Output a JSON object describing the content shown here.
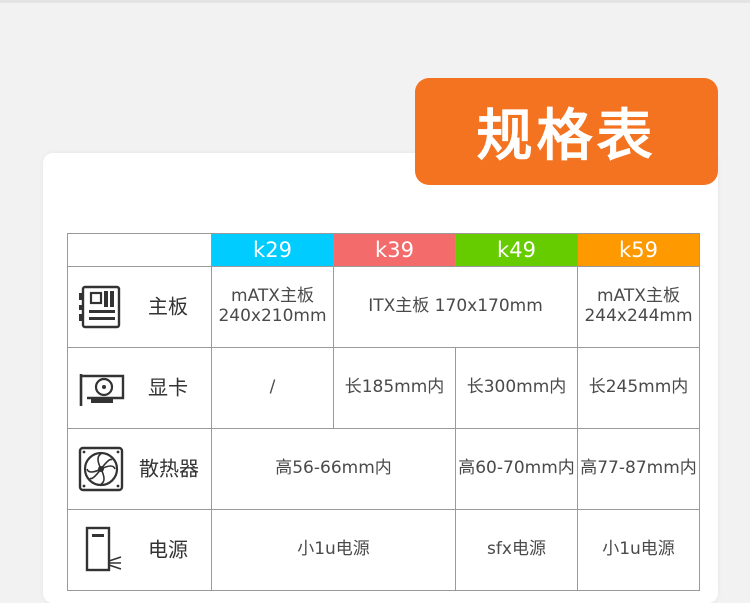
{
  "title": "规格表",
  "colors": {
    "title_bg": "#f47320",
    "k29": "#00ccff",
    "k39": "#f46b6b",
    "k49": "#66cc00",
    "k59": "#ff9900"
  },
  "models": [
    "k29",
    "k39",
    "k49",
    "k59"
  ],
  "rows": {
    "motherboard": {
      "label": "主板",
      "icon": "motherboard-icon",
      "k29": "mATX主板 240x210mm",
      "k39_k49": "ITX主板 170x170mm",
      "k59": "mATX主板 244x244mm"
    },
    "gpu": {
      "label": "显卡",
      "icon": "graphics-card-icon",
      "k29": "/",
      "k39": "长185mm内",
      "k49": "长300mm内",
      "k59": "长245mm内"
    },
    "cooler": {
      "label": "散热器",
      "icon": "fan-cooler-icon",
      "k29_k39": "高56-66mm内",
      "k49": "高60-70mm内",
      "k59": "高77-87mm内"
    },
    "psu": {
      "label": "电源",
      "icon": "power-supply-icon",
      "k29_k39": "小1u电源",
      "k49": "sfx电源",
      "k59": "小1u电源"
    }
  }
}
